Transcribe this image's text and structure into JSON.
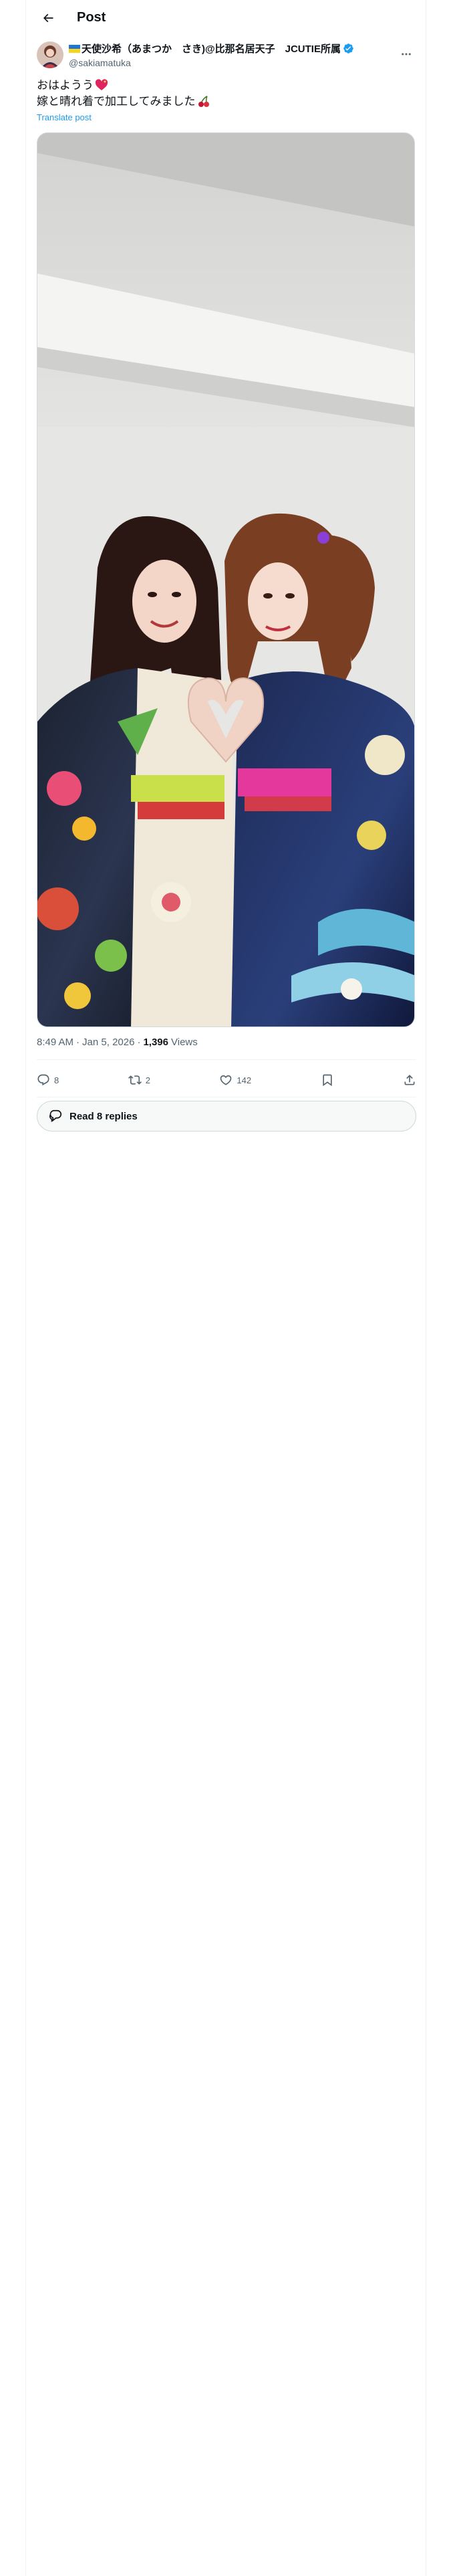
{
  "header": {
    "title": "Post"
  },
  "author": {
    "display_name": "天使沙希（あまつか　さき)@比那名居天子　JCUTIE所属",
    "handle": "@sakiamatuka"
  },
  "post": {
    "line1": "おはようう",
    "line2": "嫁と晴れ着で加工してみました",
    "translate_label": "Translate post"
  },
  "meta": {
    "time": "8:49 AM",
    "date": "Jan 5, 2026",
    "views_count": "1,396",
    "views_label": "Views",
    "separator": "·"
  },
  "actions": {
    "replies": "8",
    "reposts": "2",
    "likes": "142"
  },
  "read_replies_label": "Read 8 replies",
  "colors": {
    "accent": "#1d9bf0",
    "muted": "#536471",
    "border": "#cfd9de"
  }
}
